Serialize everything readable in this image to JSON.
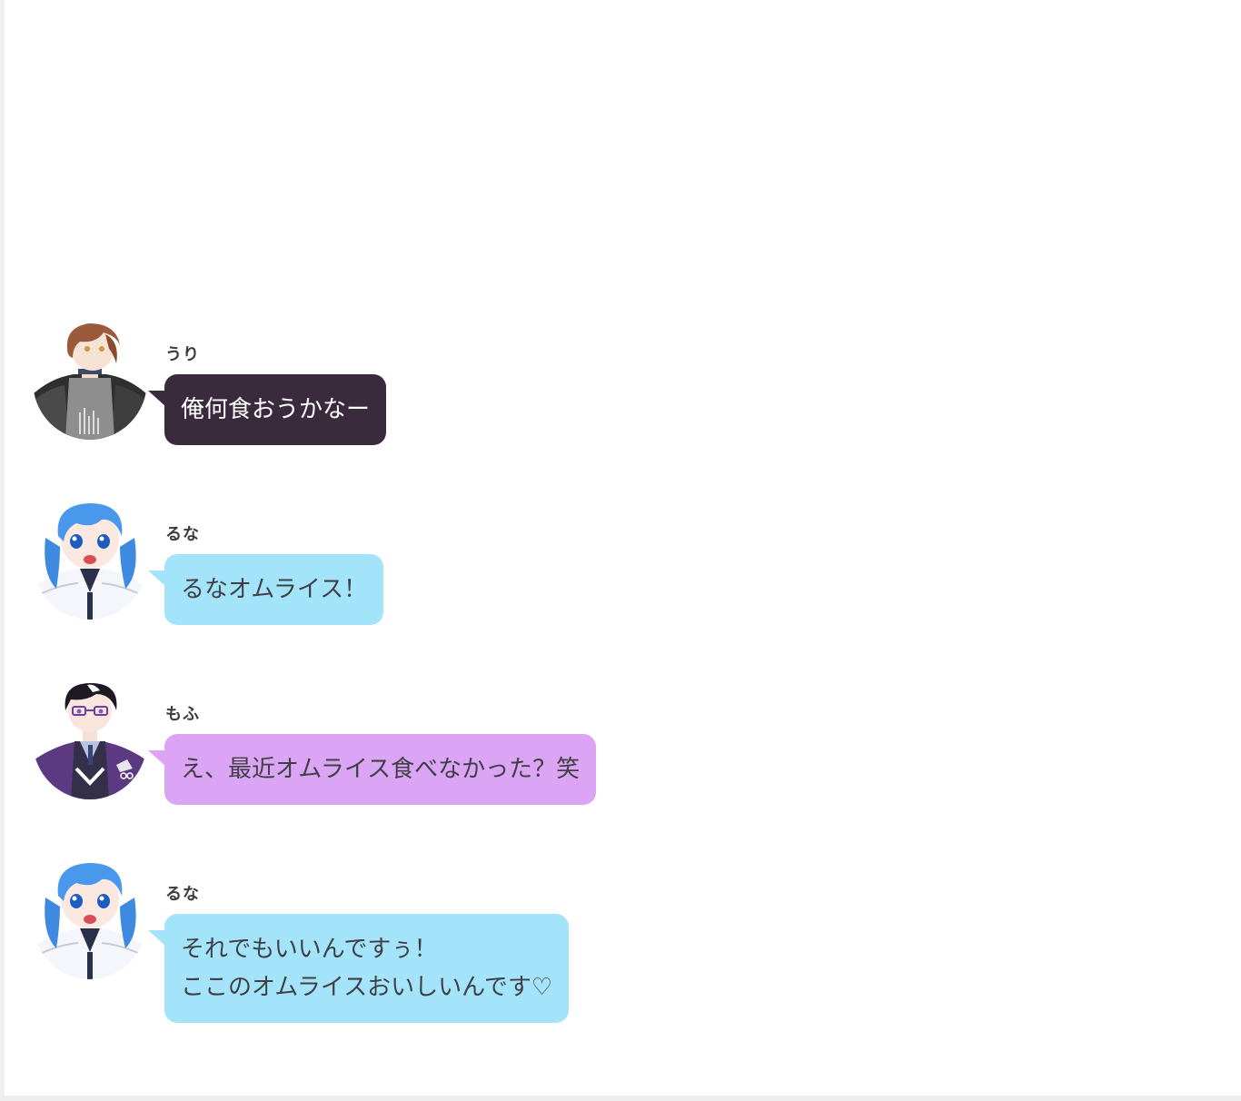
{
  "messages": [
    {
      "speaker": "うり",
      "avatar": "uri-avatar-icon",
      "style": "dark",
      "lines": [
        "俺何食おうかなー"
      ]
    },
    {
      "speaker": "るな",
      "avatar": "runa-avatar-icon",
      "style": "blue",
      "lines": [
        "るなオムライス！"
      ]
    },
    {
      "speaker": "もふ",
      "avatar": "mofu-avatar-icon",
      "style": "purple",
      "lines": [
        "え、最近オムライス食べなかった？笑"
      ]
    },
    {
      "speaker": "るな",
      "avatar": "runa-avatar-icon",
      "style": "blue",
      "lines": [
        "それでもいいんですぅ！",
        "ここのオムライスおいしいんです♡"
      ]
    }
  ],
  "colors": {
    "dark_bubble": "#392b3b",
    "blue_bubble": "#a4e4fb",
    "purple_bubble": "#dba4f4",
    "name_text": "#3d3d3d"
  }
}
